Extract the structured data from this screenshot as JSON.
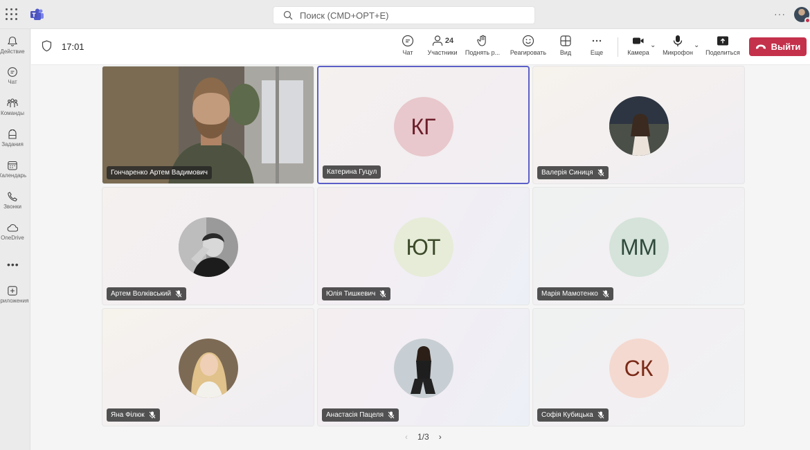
{
  "app": {
    "search_placeholder": "Поиск (CMD+OPT+E)"
  },
  "rail": {
    "items": [
      {
        "label": "Действие",
        "icon": "bell-icon"
      },
      {
        "label": "Чат",
        "icon": "chat-icon"
      },
      {
        "label": "Команды",
        "icon": "teams-icon"
      },
      {
        "label": "Задания",
        "icon": "assignments-icon"
      },
      {
        "label": "Календарь",
        "icon": "calendar-icon"
      },
      {
        "label": "Звонки",
        "icon": "phone-icon"
      },
      {
        "label": "OneDrive",
        "icon": "cloud-icon"
      },
      {
        "label": "Приложения",
        "icon": "add-apps-icon"
      }
    ],
    "more": "•••"
  },
  "meeting": {
    "time": "17:01",
    "toolbar": {
      "chat": "Чат",
      "participants_count": "24",
      "participants": "Участники",
      "raise_hand": "Поднять р...",
      "react": "Реагировать",
      "view": "Вид",
      "more": "Еще",
      "camera": "Камера",
      "mic": "Микрофон",
      "share": "Поделиться",
      "leave": "Выйти"
    },
    "leave_color": "#c4314b",
    "active_speaker_color": "#5b5fc7"
  },
  "participants": [
    {
      "name": "Гончаренко Артем Вадимович",
      "initials": "",
      "type": "video",
      "muted": false
    },
    {
      "name": "Катерина Гуцул",
      "initials": "КГ",
      "type": "initials",
      "muted": false,
      "active": true,
      "avatar_bg": "#e8c8cc",
      "avatar_fg": "#6b1e2a"
    },
    {
      "name": "Валерія Синиця",
      "initials": "",
      "type": "photo",
      "muted": true
    },
    {
      "name": "Артем Волківський",
      "initials": "",
      "type": "photo",
      "muted": true
    },
    {
      "name": "Юлія Тишкевич",
      "initials": "ЮТ",
      "type": "initials",
      "muted": true,
      "avatar_bg": "#e6ecd8",
      "avatar_fg": "#3d4a2a"
    },
    {
      "name": "Марія Мамотенко",
      "initials": "ММ",
      "type": "initials",
      "muted": true,
      "avatar_bg": "#d5e3da",
      "avatar_fg": "#2f4a3c"
    },
    {
      "name": "Яна Філюк",
      "initials": "",
      "type": "photo",
      "muted": true
    },
    {
      "name": "Анастасія Пацеля",
      "initials": "",
      "type": "photo",
      "muted": true
    },
    {
      "name": "Софія Кубицька",
      "initials": "СК",
      "type": "initials",
      "muted": true,
      "avatar_bg": "#f4d9d0",
      "avatar_fg": "#7a2a18"
    }
  ],
  "pagination": {
    "label": "1/3",
    "prev": "‹",
    "next": "›"
  }
}
